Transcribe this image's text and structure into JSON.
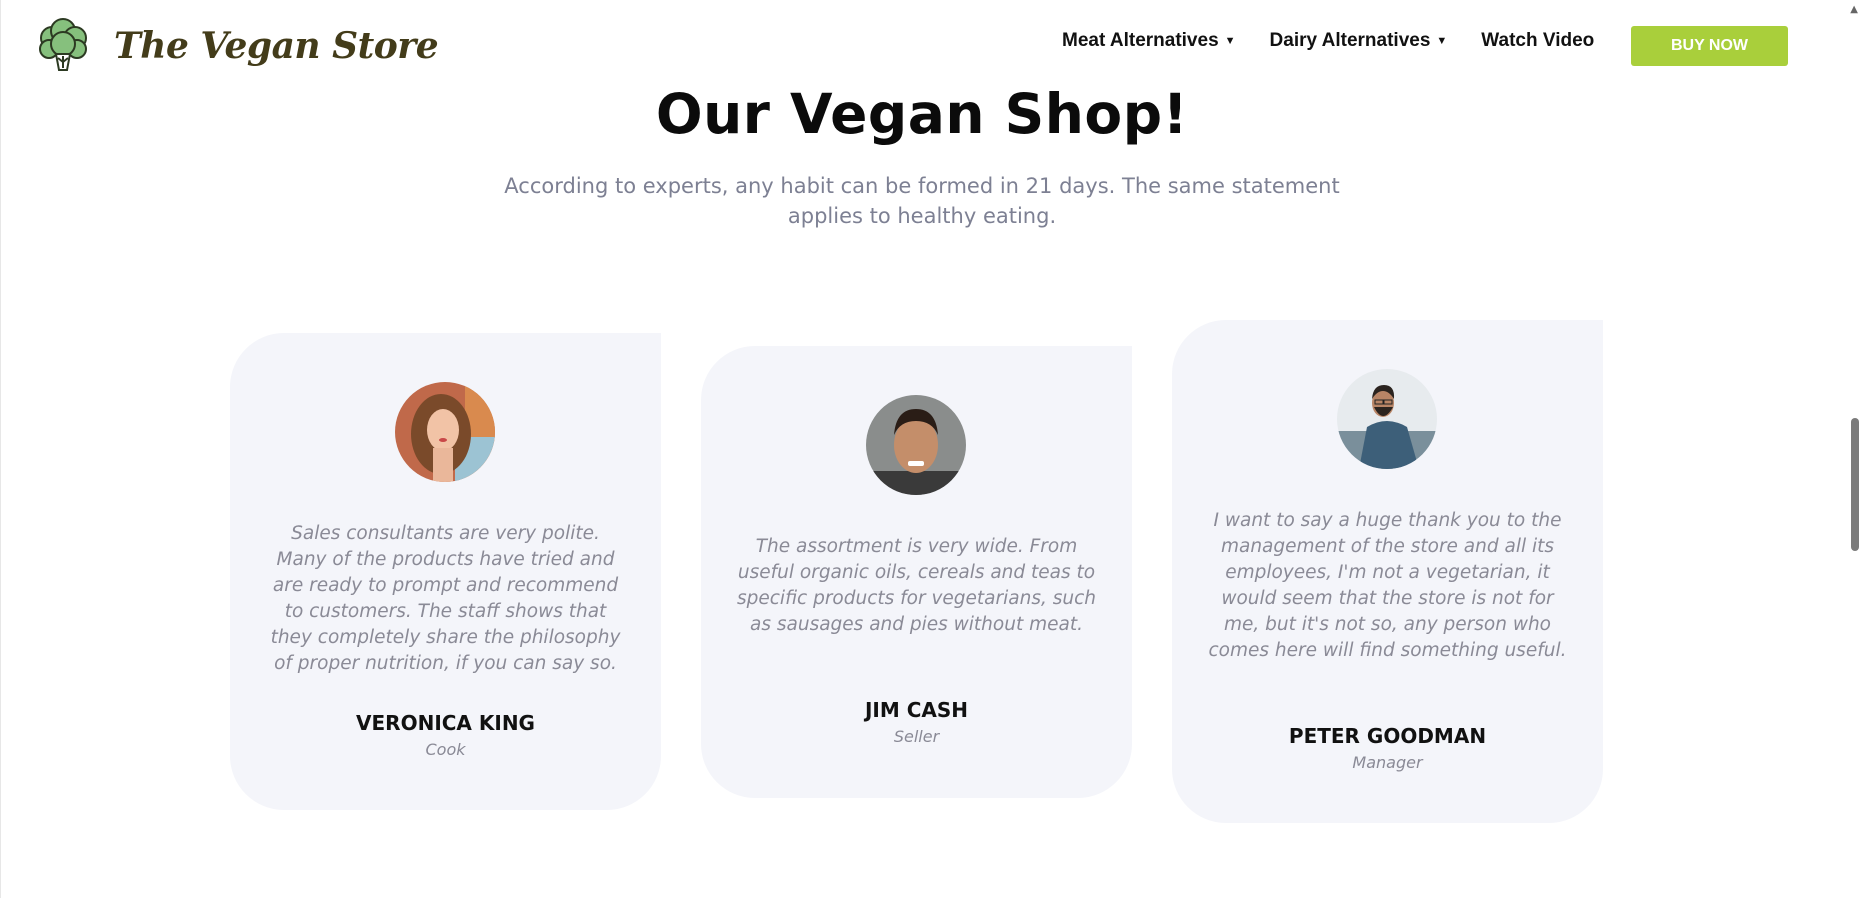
{
  "header": {
    "site_title": "The Vegan Store",
    "logo_icon": "broccoli-icon",
    "nav": [
      {
        "label": "Meat Alternatives",
        "has_dropdown": true
      },
      {
        "label": "Dairy Alternatives",
        "has_dropdown": true
      },
      {
        "label": "Watch Video",
        "has_dropdown": false
      }
    ],
    "dropdown_icon": "caret-down-icon",
    "buy_label": "BUY NOW"
  },
  "section": {
    "title": "Our Vegan Shop!",
    "subtitle": "According to experts, any habit can be formed in 21 days. The same statement applies to healthy eating."
  },
  "testimonials": [
    {
      "quote": "Sales consultants are very polite. Many of the products have tried and are ready to prompt and recommend to customers. The staff shows that they completely share the philosophy of proper nutrition, if you can say so.",
      "name": "VERONICA KING",
      "role": "Cook"
    },
    {
      "quote": "The assortment is very wide. From useful organic oils, cereals and teas to specific products for vegetarians, such as sausages and pies without meat.",
      "name": "JIM CASH",
      "role": "Seller"
    },
    {
      "quote": "I want to say a huge thank you to the management of the store and all its employees, I'm not a vegetarian, it would seem that the store is not for me, but it's not so, any person who comes here will find something useful.",
      "name": "PETER GOODMAN",
      "role": "Manager"
    }
  ],
  "colors": {
    "accent": "#a9cf3b",
    "card_bg": "#f4f5fa",
    "logo_text": "#433c1a",
    "muted_text": "#8a8a96"
  }
}
